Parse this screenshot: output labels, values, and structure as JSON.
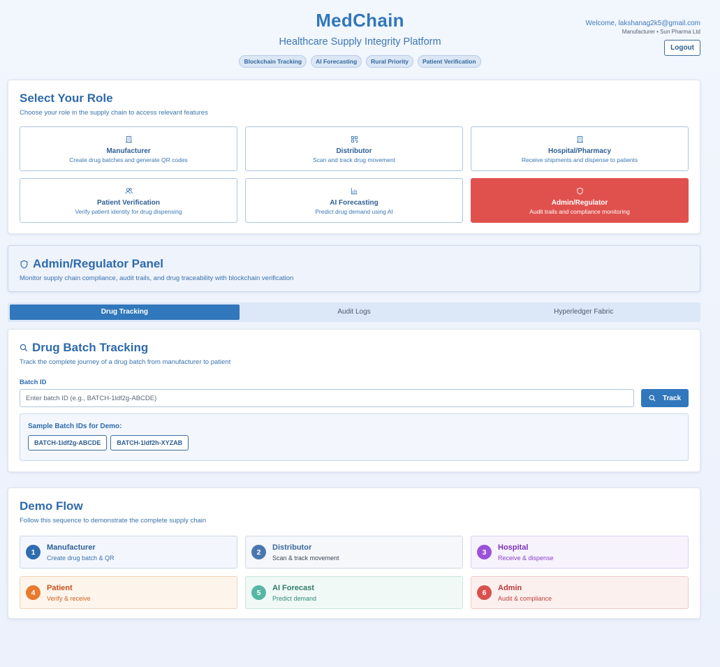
{
  "header": {
    "title": "MedChain",
    "subtitle": "Healthcare Supply Integrity Platform",
    "chips": [
      "Blockchain Tracking",
      "AI Forecasting",
      "Rural Priority",
      "Patient Verification"
    ],
    "welcome": "Welcome, lakshanag2k5@gmail.com",
    "org": "Manufacturer • Sun Pharma Ltd",
    "logout": "Logout"
  },
  "roles": {
    "title": "Select Your Role",
    "description": "Choose your role in the supply chain to access relevant features",
    "items": [
      {
        "title": "Manufacturer",
        "desc": "Create drug batches and generate QR codes",
        "icon": "building-icon"
      },
      {
        "title": "Distributor",
        "desc": "Scan and track drug movement",
        "icon": "qr-code-icon"
      },
      {
        "title": "Hospital/Pharmacy",
        "desc": "Receive shipments and dispense to patients",
        "icon": "building-icon"
      },
      {
        "title": "Patient Verification",
        "desc": "Verify patient identity for drug dispensing",
        "icon": "users-icon"
      },
      {
        "title": "AI Forecasting",
        "desc": "Predict drug demand using AI",
        "icon": "bar-chart-icon"
      },
      {
        "title": "Admin/Regulator",
        "desc": "Audit trails and compliance monitoring",
        "icon": "shield-icon",
        "active": true
      }
    ]
  },
  "panel": {
    "title": "Admin/Regulator Panel",
    "description": "Monitor supply chain compliance, audit trails, and drug traceability with blockchain verification"
  },
  "tabs": [
    {
      "label": "Drug Tracking",
      "active": true
    },
    {
      "label": "Audit Logs"
    },
    {
      "label": "Hyperledger Fabric"
    }
  ],
  "tracking": {
    "title": "Drug Batch Tracking",
    "description": "Track the complete journey of a drug batch from manufacturer to patient",
    "batch_label": "Batch ID",
    "placeholder": "Enter batch ID (e.g., BATCH-1ldf2g-ABCDE)",
    "track_label": "Track",
    "sample_title": "Sample Batch IDs for Demo:",
    "samples": [
      "BATCH-1ldf2g-ABCDE",
      "BATCH-1ldf2h-XYZAB"
    ]
  },
  "demo": {
    "title": "Demo Flow",
    "description": "Follow this sequence to demonstrate the complete supply chain",
    "steps": [
      {
        "num": "1",
        "title": "Manufacturer",
        "desc": "Create drug batch & QR",
        "color": "#2f6db0",
        "bg": "#f3f7fd",
        "border": "#c8d7e8",
        "title_color": "#2e5f95",
        "desc_color": "#3a73ad"
      },
      {
        "num": "2",
        "title": "Distributor",
        "desc": "Scan & track movement",
        "color": "#4a76b0",
        "bg": "#f5f7fb",
        "border": "#cfd9e6",
        "title_color": "#3a6aa0",
        "desc_color": "#3c4656"
      },
      {
        "num": "3",
        "title": "Hospital",
        "desc": "Receive & dispense",
        "color": "#9b52d9",
        "bg": "#f7f3fd",
        "border": "#ddcff1",
        "title_color": "#7b2fb4",
        "desc_color": "#8a3ec4"
      },
      {
        "num": "4",
        "title": "Patient",
        "desc": "Verify & receive",
        "color": "#ea7a2e",
        "bg": "#fdf5ec",
        "border": "#f1d2b5",
        "title_color": "#c8521c",
        "desc_color": "#d0601f"
      },
      {
        "num": "5",
        "title": "AI Forecast",
        "desc": "Predict demand",
        "color": "#55b7a4",
        "bg": "#f1f9f6",
        "border": "#c4e6dc",
        "title_color": "#2f7c6a",
        "desc_color": "#2f8a74"
      },
      {
        "num": "6",
        "title": "Admin",
        "desc": "Audit & compliance",
        "color": "#d9504c",
        "bg": "#fcf0ef",
        "border": "#efc9c7",
        "title_color": "#b73a36",
        "desc_color": "#c0403b"
      }
    ]
  }
}
